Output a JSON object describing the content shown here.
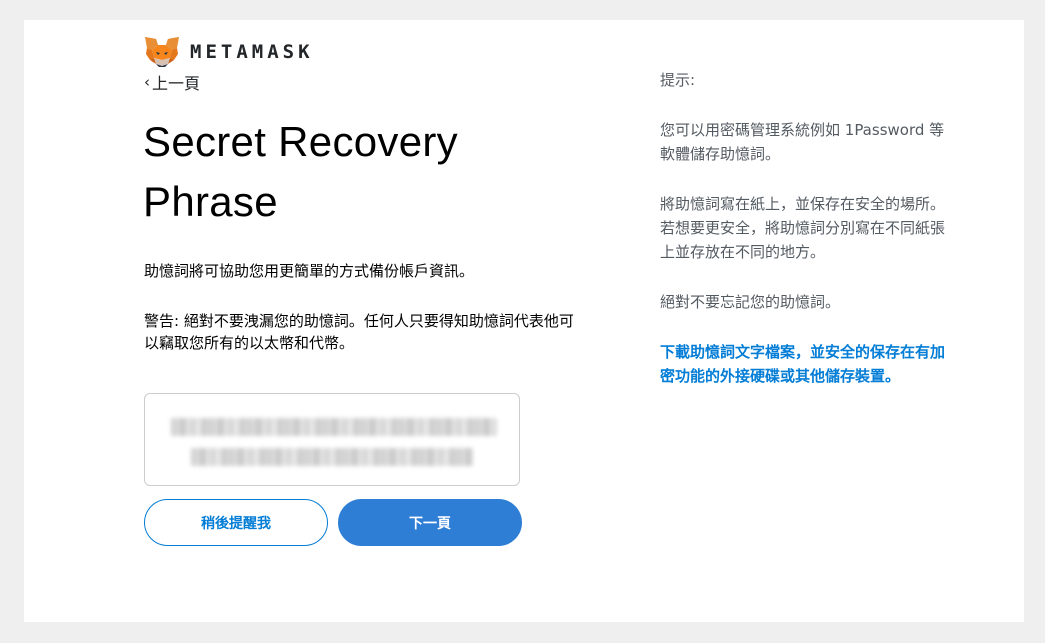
{
  "header": {
    "brand": "METAMASK",
    "logo_icon": "metamask-fox-icon"
  },
  "nav": {
    "back_label": "上一頁",
    "back_icon": "chevron-left-icon"
  },
  "main": {
    "title": "Secret Recovery Phrase",
    "intro": "助憶詞將可協助您用更簡單的方式備份帳戶資訊。",
    "warning": "警告: 絕對不要洩漏您的助憶詞。任何人只要得知助憶詞代表他可以竊取您所有的以太幣和代幣。",
    "remind_later_label": "稍後提醒我",
    "next_label": "下一頁"
  },
  "tips": {
    "title": "提示:",
    "items": [
      "您可以用密碼管理系統例如 1Password 等軟體儲存助憶詞。",
      "將助憶詞寫在紙上，並保存在安全的場所。若想要更安全，將助憶詞分別寫在不同紙張上並存放在不同的地方。",
      "絕對不要忘記您的助憶詞。"
    ],
    "download_link": "下載助憶詞文字檔案，並安全的保存在有加密功能的外接硬碟或其他儲存裝置。"
  },
  "colors": {
    "accent": "#037dd6",
    "primary_button": "#2f7ed6",
    "tip_text": "#535a61",
    "background": "#efefef"
  }
}
